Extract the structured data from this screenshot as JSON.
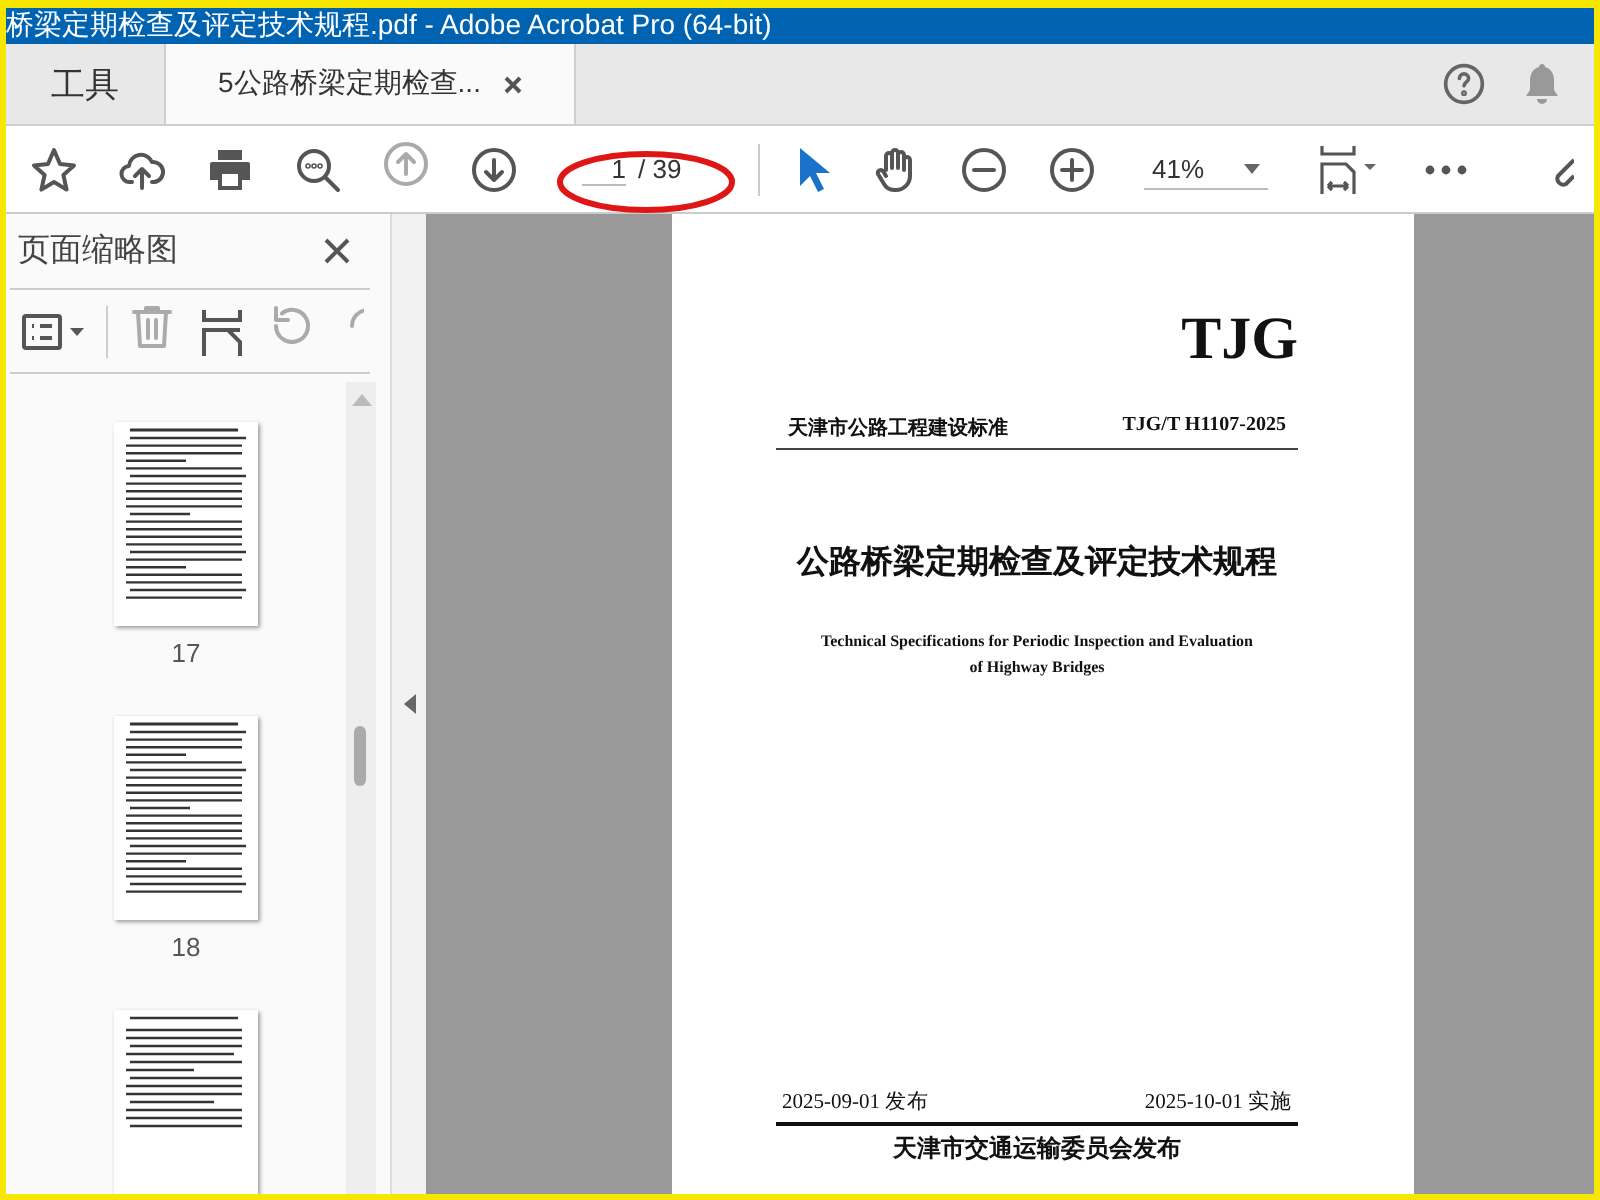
{
  "window": {
    "title": "桥梁定期检查及评定技术规程.pdf - Adobe Acrobat Pro (64-bit)"
  },
  "tabs": [
    {
      "label": "工具",
      "selected": false,
      "closable": false
    },
    {
      "label": "5公路桥梁定期检查...",
      "selected": true,
      "closable": true
    }
  ],
  "toolbar": {
    "page_value": "1",
    "page_total": "/ 39",
    "zoom": "41%",
    "annotation": true
  },
  "sidebar": {
    "title": "页面缩略图",
    "thumbnails": [
      {
        "label": "17"
      },
      {
        "label": "18"
      }
    ],
    "partial_thumbnail": true
  },
  "document": {
    "mark": "TJG",
    "series": "天津市公路工程建设标准",
    "code": "TJG/T H1107-2025",
    "title": "公路桥梁定期检查及评定技术规程",
    "english_title": [
      "Technical Specifications for Periodic Inspection and Evaluation",
      "of Highway Bridges"
    ],
    "issued": "2025-09-01 发布",
    "effective": "2025-10-01 实施",
    "publisher": "天津市交通运输委员会发布"
  }
}
